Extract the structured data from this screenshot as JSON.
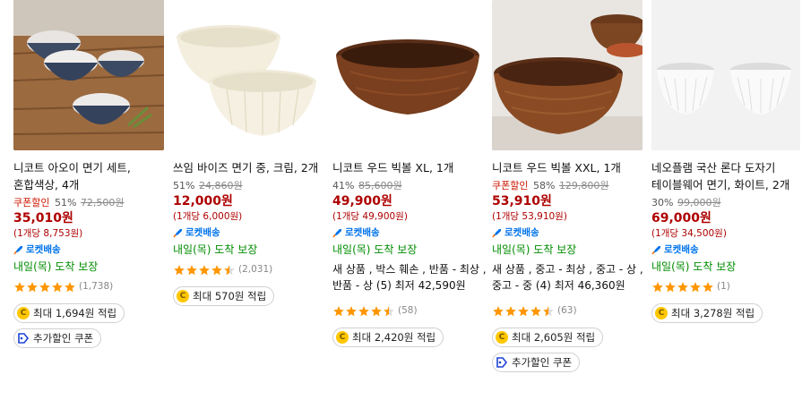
{
  "products": [
    {
      "name": "니코트 아오이 면기 세트, 혼합색상, 4개",
      "coupon_label": "쿠폰할인",
      "discount": "51%",
      "original_price": "72,500원",
      "price": "35,010원",
      "unit_price": "(1개당 8,753원)",
      "rocket": "로켓배송",
      "delivery": "내일(목) 도착 보장",
      "stars": 5,
      "review_count": "(1,738)",
      "reward": "최대 1,694원 적립",
      "extra_coupon": "추가할인 쿠폰"
    },
    {
      "name": "쓰임 바이즈 면기 중, 크림, 2개",
      "discount": "51%",
      "original_price": "24,860원",
      "price": "12,000원",
      "unit_price": "(1개당 6,000원)",
      "rocket": "로켓배송",
      "delivery": "내일(목) 도착 보장",
      "stars": 4.5,
      "review_count": "(2,031)",
      "reward": "최대 570원 적립"
    },
    {
      "name": "니코트 우드 빅볼 XL, 1개",
      "discount": "41%",
      "original_price": "85,600원",
      "price": "49,900원",
      "unit_price": "(1개당 49,900원)",
      "rocket": "로켓배송",
      "delivery": "내일(목) 도착 보장",
      "used": "새 상품 , 박스 훼손 , 반품 - 최상 , 반품 - 상 (5) 최저 42,590원",
      "stars": 4.5,
      "review_count": "(58)",
      "reward": "최대 2,420원 적립"
    },
    {
      "name": "니코트 우드 빅볼 XXL, 1개",
      "coupon_label": "쿠폰할인",
      "discount": "58%",
      "original_price": "129,800원",
      "price": "53,910원",
      "unit_price": "(1개당 53,910원)",
      "rocket": "로켓배송",
      "delivery": "내일(목) 도착 보장",
      "used": "새 상품 , 중고 - 최상 , 중고 - 상 , 중고 - 중 (4) 최저 46,360원",
      "stars": 4.5,
      "review_count": "(63)",
      "reward": "최대 2,605원 적립",
      "extra_coupon": "추가할인 쿠폰"
    },
    {
      "name": "네오플램 국산 론다 도자기 테이블웨어 면기, 화이트, 2개",
      "discount": "30%",
      "original_price": "99,000원",
      "price": "69,000원",
      "unit_price": "(1개당 34,500원)",
      "rocket": "로켓배송",
      "delivery": "내일(목) 도착 보장",
      "stars": 5,
      "review_count": "(1)",
      "reward": "최대 3,278원 적립"
    }
  ],
  "colors": {
    "price": "#ae0000",
    "delivery": "#008c00",
    "rocket": "#0073e9",
    "star": "#ff9600"
  }
}
